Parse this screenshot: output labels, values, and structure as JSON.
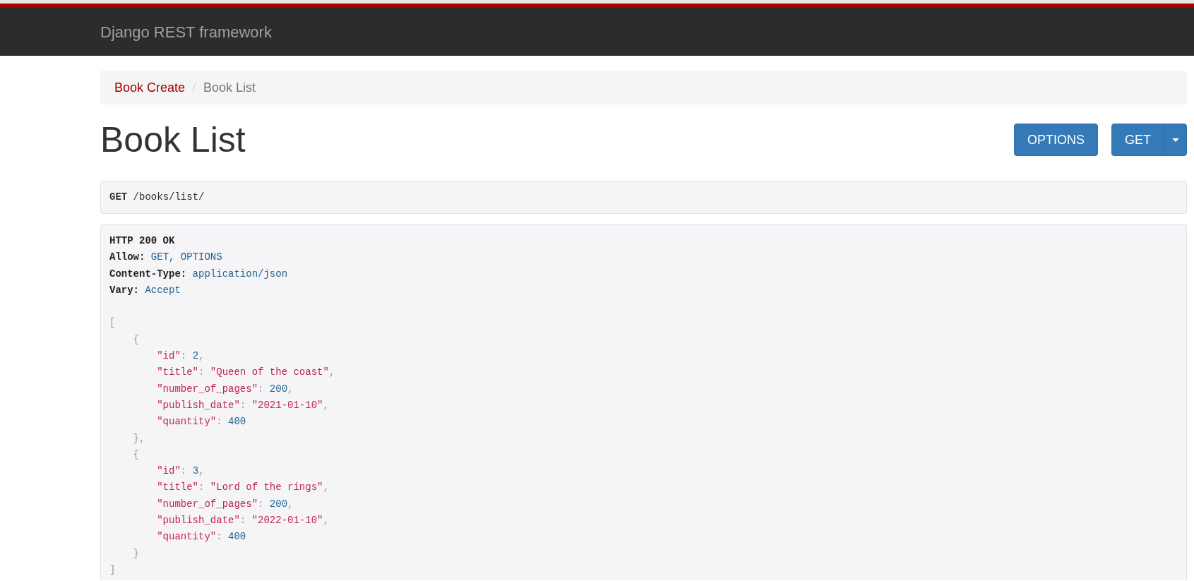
{
  "navbar": {
    "brand": "Django REST framework"
  },
  "breadcrumbs": [
    {
      "label": "Book Create",
      "active": false
    },
    {
      "label": "Book List",
      "active": true
    }
  ],
  "page_title": "Book List",
  "buttons": [
    {
      "label": "OPTIONS",
      "kind": "plain"
    },
    {
      "label": "GET",
      "kind": "split"
    }
  ],
  "request": {
    "method": "GET",
    "path": "/books/list/"
  },
  "response": {
    "status": "HTTP 200 OK",
    "headers": [
      {
        "name": "Allow:",
        "value": "GET, OPTIONS"
      },
      {
        "name": "Content-Type:",
        "value": "application/json"
      },
      {
        "name": "Vary:",
        "value": "Accept"
      }
    ],
    "body_lines": [
      [
        {
          "kind": "punct",
          "text": "["
        }
      ],
      [
        {
          "kind": "punct",
          "text": "    {"
        }
      ],
      [
        {
          "kind": "key",
          "text": "        \"id\""
        },
        {
          "kind": "punct",
          "text": ": "
        },
        {
          "kind": "number",
          "text": "2"
        },
        {
          "kind": "punct",
          "text": ","
        }
      ],
      [
        {
          "kind": "key",
          "text": "        \"title\""
        },
        {
          "kind": "punct",
          "text": ": "
        },
        {
          "kind": "string",
          "text": "\"Queen of the coast\""
        },
        {
          "kind": "punct",
          "text": ","
        }
      ],
      [
        {
          "kind": "key",
          "text": "        \"number_of_pages\""
        },
        {
          "kind": "punct",
          "text": ": "
        },
        {
          "kind": "number",
          "text": "200"
        },
        {
          "kind": "punct",
          "text": ","
        }
      ],
      [
        {
          "kind": "key",
          "text": "        \"publish_date\""
        },
        {
          "kind": "punct",
          "text": ": "
        },
        {
          "kind": "string",
          "text": "\"2021-01-10\""
        },
        {
          "kind": "punct",
          "text": ","
        }
      ],
      [
        {
          "kind": "key",
          "text": "        \"quantity\""
        },
        {
          "kind": "punct",
          "text": ": "
        },
        {
          "kind": "number",
          "text": "400"
        }
      ],
      [
        {
          "kind": "punct",
          "text": "    },"
        }
      ],
      [
        {
          "kind": "punct",
          "text": "    {"
        }
      ],
      [
        {
          "kind": "key",
          "text": "        \"id\""
        },
        {
          "kind": "punct",
          "text": ": "
        },
        {
          "kind": "number",
          "text": "3"
        },
        {
          "kind": "punct",
          "text": ","
        }
      ],
      [
        {
          "kind": "key",
          "text": "        \"title\""
        },
        {
          "kind": "punct",
          "text": ": "
        },
        {
          "kind": "string",
          "text": "\"Lord of the rings\""
        },
        {
          "kind": "punct",
          "text": ","
        }
      ],
      [
        {
          "kind": "key",
          "text": "        \"number_of_pages\""
        },
        {
          "kind": "punct",
          "text": ": "
        },
        {
          "kind": "number",
          "text": "200"
        },
        {
          "kind": "punct",
          "text": ","
        }
      ],
      [
        {
          "kind": "key",
          "text": "        \"publish_date\""
        },
        {
          "kind": "punct",
          "text": ": "
        },
        {
          "kind": "string",
          "text": "\"2022-01-10\""
        },
        {
          "kind": "punct",
          "text": ","
        }
      ],
      [
        {
          "kind": "key",
          "text": "        \"quantity\""
        },
        {
          "kind": "punct",
          "text": ": "
        },
        {
          "kind": "number",
          "text": "400"
        }
      ],
      [
        {
          "kind": "punct",
          "text": "    }"
        }
      ],
      [
        {
          "kind": "punct",
          "text": "]"
        }
      ]
    ]
  }
}
